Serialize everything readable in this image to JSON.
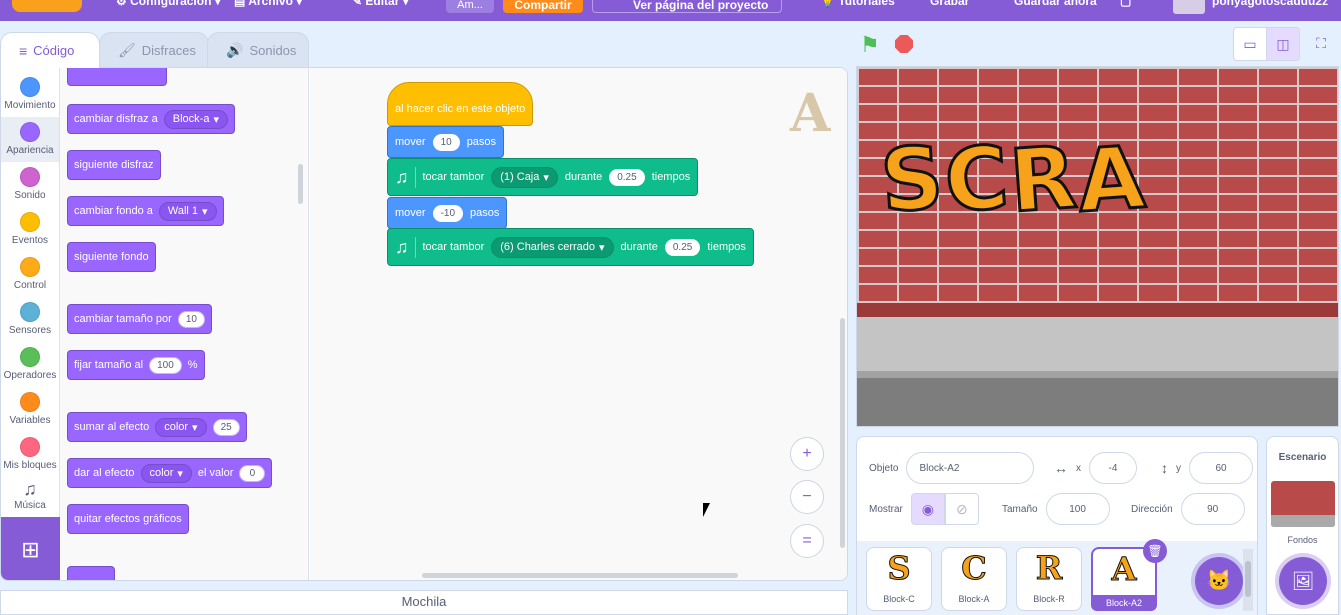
{
  "menubar": {
    "logo": "Scratch",
    "settings": "Configuración",
    "file": "Archivo",
    "edit": "Editar",
    "title_field": "Am...",
    "share": "Compartir",
    "project_page": "Ver página del proyecto",
    "tutorials": "Tutoriales",
    "save": "Grabar",
    "save_now": "Guardar ahora",
    "username": "ponyagotoscaduu2z"
  },
  "tabs": [
    {
      "label": "Código",
      "icon": "code-icon"
    },
    {
      "label": "Disfraces",
      "icon": "brush-icon"
    },
    {
      "label": "Sonidos",
      "icon": "speaker-icon"
    }
  ],
  "categories": [
    {
      "label": "Movimiento",
      "color": "#4c97ff"
    },
    {
      "label": "Apariencia",
      "color": "#9966ff"
    },
    {
      "label": "Sonido",
      "color": "#cf63cf"
    },
    {
      "label": "Eventos",
      "color": "#ffbf00"
    },
    {
      "label": "Control",
      "color": "#ffab19"
    },
    {
      "label": "Sensores",
      "color": "#5cb1d6"
    },
    {
      "label": "Operadores",
      "color": "#59c059"
    },
    {
      "label": "Variables",
      "color": "#ff8c1a"
    },
    {
      "label": "Mis bloques",
      "color": "#ff6680"
    },
    {
      "label": "Música",
      "icon": "music-note-icon"
    }
  ],
  "palette": {
    "switch_costume": {
      "text": "cambiar disfraz a",
      "value": "Block-a"
    },
    "next_costume": "siguiente disfraz",
    "switch_backdrop": {
      "text": "cambiar fondo a",
      "value": "Wall 1"
    },
    "next_backdrop": "siguiente fondo",
    "change_size": {
      "text": "cambiar tamaño por",
      "value": "10"
    },
    "set_size": {
      "text": "fijar tamaño al",
      "value": "100",
      "unit": "%"
    },
    "change_effect": {
      "text": "sumar al efecto",
      "effect": "color",
      "value": "25"
    },
    "set_effect": {
      "text": "dar al efecto",
      "effect": "color",
      "mid": "el valor",
      "value": "0"
    },
    "clear_effects": "quitar efectos gráficos"
  },
  "script": {
    "hat": "al hacer clic en este objeto",
    "move1": {
      "text": "mover",
      "value": "10",
      "unit": "pasos"
    },
    "drum1": {
      "text": "tocar tambor",
      "drum": "(1) Caja",
      "mid": "durante",
      "value": "0.25",
      "unit": "tiempos"
    },
    "move2": {
      "text": "mover",
      "value": "-10",
      "unit": "pasos"
    },
    "drum2": {
      "text": "tocar tambor",
      "drum": "(6) Charles cerrado",
      "mid": "durante",
      "value": "0.25",
      "unit": "tiempos"
    }
  },
  "zoom": {
    "in": "+",
    "out": "−",
    "reset": "="
  },
  "backpack": "Mochila",
  "stage": {
    "letters": [
      "S",
      "C",
      "R",
      "A"
    ]
  },
  "sprite_info": {
    "object_label": "Objeto",
    "object_name": "Block-A2",
    "x_label": "x",
    "x_value": "-4",
    "y_label": "y",
    "y_value": "60",
    "show_label": "Mostrar",
    "size_label": "Tamaño",
    "size_value": "100",
    "direction_label": "Dirección",
    "direction_value": "90"
  },
  "sprites": [
    {
      "name": "Block-C",
      "glyph": "S"
    },
    {
      "name": "Block-A",
      "glyph": "C"
    },
    {
      "name": "Block-R",
      "glyph": "R"
    },
    {
      "name": "Block-A2",
      "glyph": "A"
    }
  ],
  "backdrop": {
    "header": "Escenario",
    "label": "Fondos"
  },
  "colors": {
    "accent": "#855cd6",
    "looks": "#9966ff",
    "motion": "#4c97ff",
    "events": "#ffbf00",
    "music": "#0fbd8c"
  }
}
